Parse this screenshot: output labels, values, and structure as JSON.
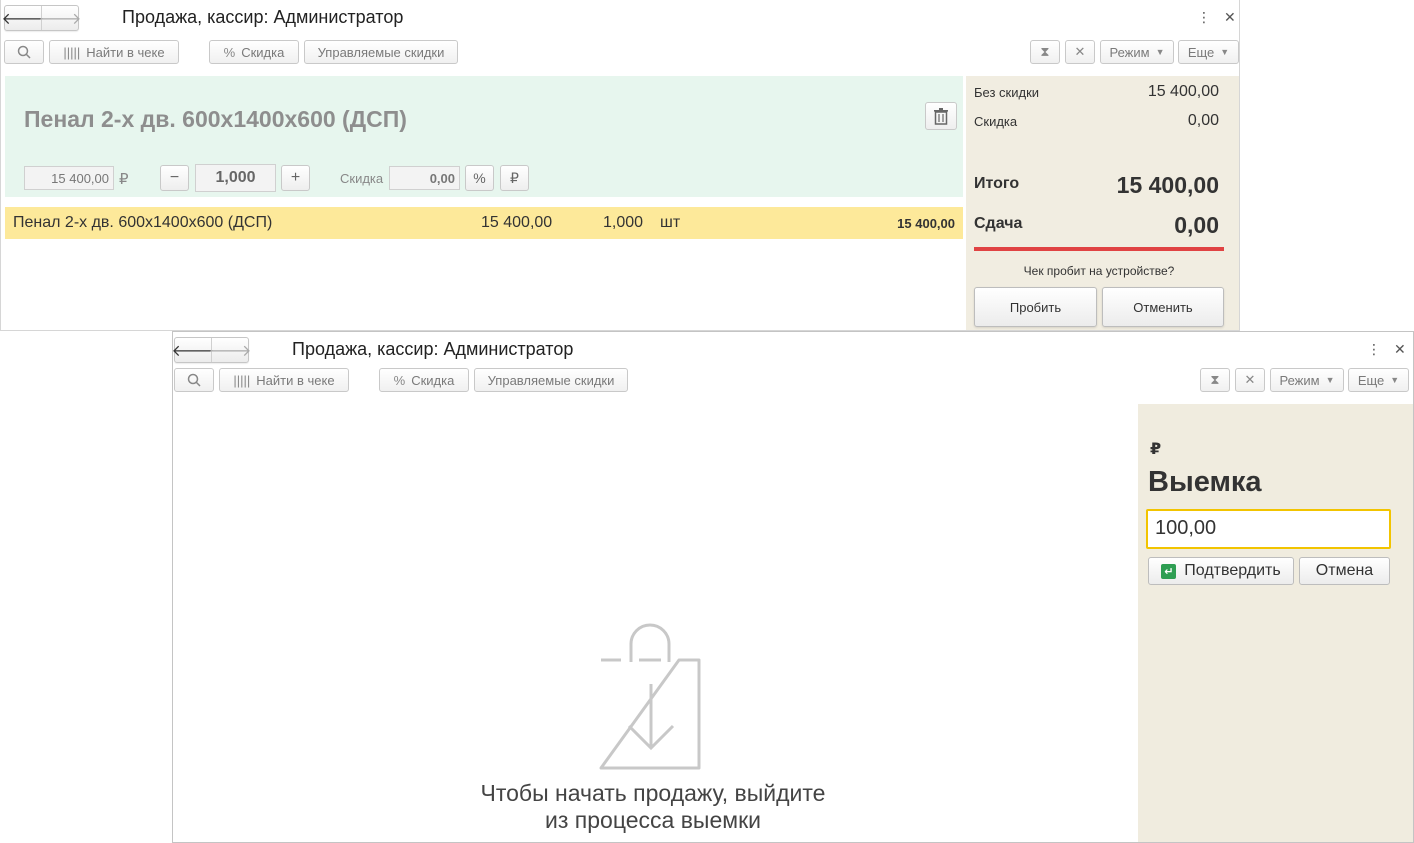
{
  "window1": {
    "title": "Продажа, кассир: Администратор",
    "toolbar": {
      "find_in_receipt": "Найти в чеке",
      "discount": "Скидка",
      "managed_discounts": "Управляемые скидки",
      "mode": "Режим",
      "more": "Еще"
    },
    "item": {
      "title": "Пенал 2-х дв. 600х1400х600 (ДСП)",
      "price": "15 400,00",
      "currency": "₽",
      "quantity": "1,000",
      "discount_label": "Скидка",
      "discount_value": "0,00",
      "percent_symbol": "%",
      "ruble_symbol": "₽"
    },
    "rows": [
      {
        "name": "Пенал 2-х дв. 600х1400х600 (ДСП)",
        "price": "15 400,00",
        "qty": "1,000",
        "unit": "шт",
        "sum": "15 400,00"
      }
    ],
    "summary": {
      "no_discount_label": "Без скидки",
      "no_discount_value": "15 400,00",
      "discount_label": "Скидка",
      "discount_value": "0,00",
      "total_label": "Итого",
      "total_value": "15 400,00",
      "change_label": "Сдача",
      "change_value": "0,00",
      "question": "Чек пробит на устройстве?",
      "confirm_btn": "Пробить",
      "cancel_btn": "Отменить"
    }
  },
  "window2": {
    "title": "Продажа, кассир: Администратор",
    "toolbar": {
      "find_in_receipt": "Найти в чеке",
      "discount": "Скидка",
      "managed_discounts": "Управляемые скидки",
      "mode": "Режим",
      "more": "Еще"
    },
    "withdrawal": {
      "currency": "₽",
      "title": "Выемка",
      "amount": "100,00",
      "confirm_btn": "Подтвердить",
      "cancel_btn": "Отмена"
    },
    "empty_message_line1": "Чтобы начать продажу, выйдите",
    "empty_message_line2": "из процесса выемки"
  },
  "icons": {
    "back": "arrow-left",
    "forward": "arrow-right",
    "search": "magnifier",
    "barcode": "barcode",
    "percent": "percent",
    "hourglass": "hourglass",
    "close": "x",
    "trash": "trash",
    "bag": "shopping-bag"
  },
  "colors": {
    "item_panel_bg": "#e7f6ee",
    "row_highlight": "#fde99a",
    "side_panel_bg": "#f1ede1",
    "change_bar": "#e04343",
    "input_focus": "#f2c400",
    "enter_icon": "#2e9e52"
  }
}
